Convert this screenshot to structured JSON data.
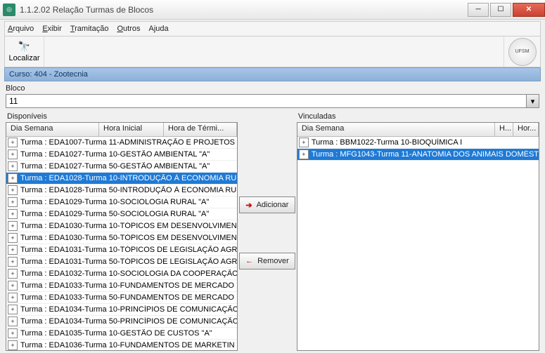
{
  "window": {
    "title": "1.1.2.02  Relação Turmas de Blocos"
  },
  "menu": {
    "arquivo": "Arquivo",
    "exibir": "Exibir",
    "tramitacao": "Tramitação",
    "outros": "Outros",
    "ajuda": "Ajuda"
  },
  "toolbar": {
    "localizar": "Localizar"
  },
  "course": {
    "label": "Curso: 404 - Zootecnia"
  },
  "bloco": {
    "label": "Bloco",
    "value": "11"
  },
  "labels": {
    "disponiveis": "Disponíveis",
    "vinculadas": "Vinculadas",
    "dia_semana": "Dia Semana",
    "hora_inicial": "Hora Inicial",
    "hora_termino": "Hora de Térmi...",
    "h": "H...",
    "hor": "Hor..."
  },
  "buttons": {
    "adicionar": "Adicionar",
    "remover": "Remover"
  },
  "disponiveis": [
    {
      "text": "Turma : EDA1007-Turma 11-ADMINISTRAÇÃO E PROJETOS",
      "selected": false
    },
    {
      "text": "Turma : EDA1027-Turma 10-GESTÃO AMBIENTAL \"A\"",
      "selected": false
    },
    {
      "text": "Turma : EDA1027-Turma 50-GESTÃO AMBIENTAL \"A\"",
      "selected": false
    },
    {
      "text": "Turma : EDA1028-Turma 10-INTRODUÇÃO À ECONOMIA RU",
      "selected": true
    },
    {
      "text": "Turma : EDA1028-Turma 50-INTRODUÇÃO À ECONOMIA RU",
      "selected": false
    },
    {
      "text": "Turma : EDA1029-Turma 10-SOCIOLOGIA RURAL \"A\"",
      "selected": false
    },
    {
      "text": "Turma : EDA1029-Turma 50-SOCIOLOGIA RURAL \"A\"",
      "selected": false
    },
    {
      "text": "Turma : EDA1030-Turma 10-TÓPICOS EM DESENVOLVIMEN",
      "selected": false
    },
    {
      "text": "Turma : EDA1030-Turma 50-TÓPICOS EM DESENVOLVIMEN",
      "selected": false
    },
    {
      "text": "Turma : EDA1031-Turma 10-TÓPICOS DE LEGISLAÇÃO AGR",
      "selected": false
    },
    {
      "text": "Turma : EDA1031-Turma 50-TÓPICOS DE LEGISLAÇÃO AGR",
      "selected": false
    },
    {
      "text": "Turma : EDA1032-Turma 10-SOCIOLOGIA DA COOPERAÇÃO",
      "selected": false
    },
    {
      "text": "Turma : EDA1033-Turma 10-FUNDAMENTOS DE MERCADO",
      "selected": false
    },
    {
      "text": "Turma : EDA1033-Turma 50-FUNDAMENTOS DE MERCADO",
      "selected": false
    },
    {
      "text": "Turma : EDA1034-Turma 10-PRINCÍPIOS DE COMUNICAÇÃO",
      "selected": false
    },
    {
      "text": "Turma : EDA1034-Turma 50-PRINCÍPIOS DE COMUNICAÇÃO",
      "selected": false
    },
    {
      "text": "Turma : EDA1035-Turma 10-GESTÃO DE CUSTOS \"A\"",
      "selected": false
    },
    {
      "text": "Turma : EDA1036-Turma 10-FUNDAMENTOS DE MARKETIN",
      "selected": false
    }
  ],
  "vinculadas": [
    {
      "text": "Turma : BBM1022-Turma 10-BIOQUÍMICA I",
      "selected": false
    },
    {
      "text": "Turma : MFG1043-Turma 11-ANATOMIA DOS ANIMAIS DOMÉST",
      "selected": true
    }
  ]
}
